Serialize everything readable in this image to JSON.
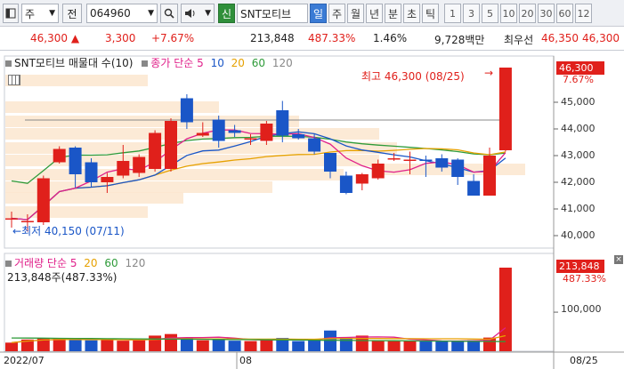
{
  "toolbar": {
    "market_label": "주",
    "prev_label": "전",
    "stock_code": "064960",
    "new_badge": "신",
    "stock_name": "SNT모티브",
    "periods": [
      {
        "label": "일",
        "active": true
      },
      {
        "label": "주",
        "active": false
      },
      {
        "label": "월",
        "active": false
      },
      {
        "label": "년",
        "active": false
      },
      {
        "label": "분",
        "active": false
      },
      {
        "label": "초",
        "active": false
      },
      {
        "label": "틱",
        "active": false
      }
    ],
    "intervals": [
      "1",
      "3",
      "5",
      "10",
      "20",
      "30",
      "60",
      "12"
    ]
  },
  "info": {
    "price": "46,300",
    "change_arrow": "▲",
    "change": "3,300",
    "change_pct": "+7.67%",
    "volume": "213,848",
    "volume_ratio": "487.33%",
    "turnover_pct": "1.46%",
    "amount": "9,728백만",
    "best_offer_label": "최우선",
    "best_offer1": "46,350",
    "best_offer2": "46,300"
  },
  "price_chart": {
    "title": "SNT모티브 매물대 수(10)",
    "ma_label": "종가 단순 5",
    "ma_periods": [
      "10",
      "20",
      "60",
      "120"
    ],
    "high_annotation": "최고 46,300 (08/25)",
    "low_annotation": "최저 40,150 (07/11)",
    "current_price_tag": "46,300",
    "current_pct": "7.67%",
    "y_ticks": [
      "45,000",
      "44,000",
      "43,000",
      "42,000",
      "41,000",
      "40,000"
    ]
  },
  "volume_chart": {
    "title": "거래량 단순 5",
    "ma_periods": [
      "20",
      "60",
      "120"
    ],
    "volume_text": "213,848주(487.33%)",
    "current_tag": "213,848",
    "current_pct": "487.33%",
    "y_tick": "100,000"
  },
  "x_axis": {
    "labels": [
      "2022/07",
      "08",
      "08/25"
    ]
  },
  "colors": {
    "up": "#e0201b",
    "down": "#1a56c7",
    "ma5": "#e0208a",
    "ma10": "#1a56c7",
    "ma20": "#e6a100",
    "ma60": "#2f9b3a",
    "ma120": "#8a8a8a"
  },
  "chart_data": {
    "type": "candlestick",
    "candles": [
      {
        "o": 40.65,
        "h": 40.9,
        "l": 40.3,
        "c": 40.65
      },
      {
        "o": 40.5,
        "h": 40.8,
        "l": 40.15,
        "c": 40.55
      },
      {
        "o": 40.5,
        "h": 42.25,
        "l": 40.4,
        "c": 42.15
      },
      {
        "o": 42.75,
        "h": 43.35,
        "l": 42.7,
        "c": 43.25
      },
      {
        "o": 43.3,
        "h": 43.35,
        "l": 41.8,
        "c": 42.3
      },
      {
        "o": 42.75,
        "h": 42.9,
        "l": 41.8,
        "c": 42.0
      },
      {
        "o": 42.0,
        "h": 42.35,
        "l": 41.6,
        "c": 42.2
      },
      {
        "o": 42.25,
        "h": 43.4,
        "l": 42.15,
        "c": 42.8
      },
      {
        "o": 42.35,
        "h": 43.05,
        "l": 42.2,
        "c": 42.95
      },
      {
        "o": 42.5,
        "h": 43.95,
        "l": 42.4,
        "c": 43.85
      },
      {
        "o": 42.5,
        "h": 44.4,
        "l": 42.4,
        "c": 44.3
      },
      {
        "o": 45.15,
        "h": 45.3,
        "l": 44.0,
        "c": 44.25
      },
      {
        "o": 43.75,
        "h": 44.25,
        "l": 43.7,
        "c": 43.85
      },
      {
        "o": 44.35,
        "h": 44.5,
        "l": 43.3,
        "c": 43.55
      },
      {
        "o": 43.95,
        "h": 44.15,
        "l": 43.7,
        "c": 43.85
      },
      {
        "o": 43.65,
        "h": 43.8,
        "l": 43.4,
        "c": 43.65
      },
      {
        "o": 43.55,
        "h": 44.3,
        "l": 43.4,
        "c": 44.2
      },
      {
        "o": 44.7,
        "h": 45.05,
        "l": 43.5,
        "c": 43.75
      },
      {
        "o": 43.8,
        "h": 44.0,
        "l": 43.6,
        "c": 43.65
      },
      {
        "o": 43.65,
        "h": 43.8,
        "l": 43.05,
        "c": 43.15
      },
      {
        "o": 43.1,
        "h": 43.1,
        "l": 42.15,
        "c": 42.4
      },
      {
        "o": 42.25,
        "h": 42.4,
        "l": 41.55,
        "c": 41.6
      },
      {
        "o": 41.95,
        "h": 42.35,
        "l": 41.7,
        "c": 42.3
      },
      {
        "o": 42.15,
        "h": 42.85,
        "l": 42.1,
        "c": 42.7
      },
      {
        "o": 42.85,
        "h": 43.1,
        "l": 42.8,
        "c": 42.9
      },
      {
        "o": 42.85,
        "h": 43.15,
        "l": 42.3,
        "c": 42.85
      },
      {
        "o": 42.85,
        "h": 43.0,
        "l": 42.2,
        "c": 42.8
      },
      {
        "o": 42.9,
        "h": 43.05,
        "l": 42.4,
        "c": 42.55
      },
      {
        "o": 42.85,
        "h": 42.9,
        "l": 41.9,
        "c": 42.2
      },
      {
        "o": 42.05,
        "h": 42.3,
        "l": 41.5,
        "c": 41.5
      },
      {
        "o": 41.5,
        "h": 43.3,
        "l": 41.5,
        "c": 43.0
      },
      {
        "o": 43.2,
        "h": 46.3,
        "l": 43.15,
        "c": 46.3
      }
    ],
    "volume": [
      22,
      30,
      34,
      34,
      30,
      28,
      30,
      27,
      28,
      40,
      44,
      35,
      28,
      33,
      27,
      26,
      30,
      34,
      26,
      29,
      53,
      34,
      40,
      27,
      26,
      27,
      25,
      27,
      26,
      28,
      35,
      214
    ],
    "ylim": [
      39.7,
      46.6
    ]
  }
}
